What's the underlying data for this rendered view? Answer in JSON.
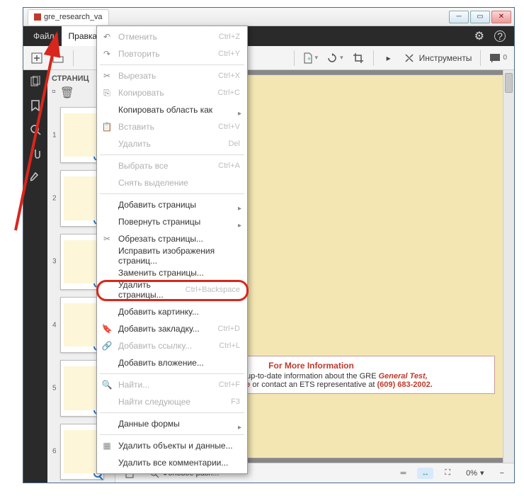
{
  "title": "gre_research_va",
  "menubar": {
    "file": "Файл",
    "edit": "Правка"
  },
  "toolbar": {
    "instruments": "Инструменты"
  },
  "thumbpanel": {
    "header": "СТРАНИЦ"
  },
  "dropdown": {
    "undo": "Отменить",
    "undo_sc": "Ctrl+Z",
    "redo": "Повторить",
    "redo_sc": "Ctrl+Y",
    "cut": "Вырезать",
    "cut_sc": "Ctrl+X",
    "copy": "Копировать",
    "copy_sc": "Ctrl+C",
    "copy_area": "Копировать область как",
    "paste": "Вставить",
    "paste_sc": "Ctrl+V",
    "delete": "Удалить",
    "delete_sc": "Del",
    "select_all": "Выбрать все",
    "select_all_sc": "Ctrl+A",
    "deselect": "Снять выделение",
    "add_pages": "Добавить страницы",
    "rotate_pages": "Повернуть страницы",
    "crop_pages": "Обрезать страницы...",
    "fix_images": "Исправить изображения страниц...",
    "replace_pages": "Заменить страницы...",
    "delete_pages": "Удалить страницы...",
    "delete_pages_sc": "Ctrl+Backspace",
    "add_picture": "Добавить картинку...",
    "add_bookmark": "Добавить закладку...",
    "add_bookmark_sc": "Ctrl+D",
    "add_link": "Добавить ссылку...",
    "add_link_sc": "Ctrl+L",
    "add_attachment": "Добавить вложение...",
    "find": "Найти...",
    "find_sc": "Ctrl+F",
    "find_next": "Найти следующее",
    "find_next_sc": "F3",
    "form_data": "Данные формы",
    "delete_objects": "Удалить объекты и данные...",
    "delete_comments": "Удалить все комментарии..."
  },
  "viewer": {
    "info_title": "For More Information",
    "info_line1_a": "o get the most up-to-date information about the GRE ",
    "info_line1_b": "General Test,",
    "info_line2_a": "www.ets.org/gre",
    "info_line2_b": " or contact an ETS representative at ",
    "info_line2_c": "(609) 683-2002."
  },
  "status": {
    "bg_layout": "Фоновое расп...",
    "zoom": "0%"
  }
}
